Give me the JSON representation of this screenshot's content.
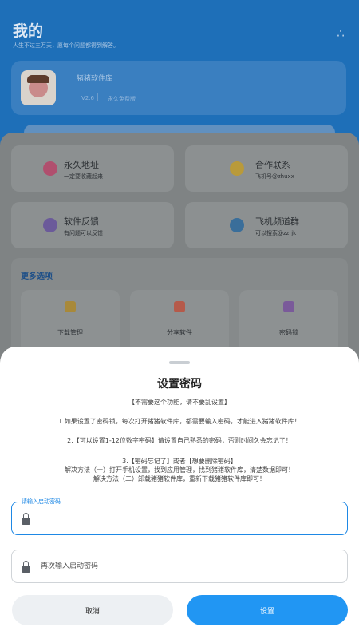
{
  "status_bar": {
    "extra": "1"
  },
  "header": {
    "title": "我的",
    "subtitle": "人生不过三万天，愿每个问题都得到解答。"
  },
  "profile": {
    "name": "猪猪软件库",
    "tag1": "V2.6",
    "tag2": "永久免费版"
  },
  "cards": [
    {
      "title": "永久地址",
      "sub": "一定要收藏起来",
      "icon": "home-icon",
      "color": "#b04f6e"
    },
    {
      "title": "合作联系",
      "sub": "飞机号@zhuxx",
      "icon": "coin-icon",
      "color": "#b99a3a"
    },
    {
      "title": "软件反馈",
      "sub": "有问题可以反馈",
      "icon": "feedback-icon",
      "color": "#6b5a9a"
    },
    {
      "title": "飞机频道群",
      "sub": "可以搜索@zzrjk",
      "icon": "telegram-icon",
      "color": "#3a6e9a"
    }
  ],
  "more": {
    "title": "更多选项",
    "options": [
      {
        "label": "下载管理",
        "icon": "download-icon",
        "color": "#a8893a"
      },
      {
        "label": "分享软件",
        "icon": "share-icon",
        "color": "#b55a4a"
      },
      {
        "label": "密码锁",
        "icon": "lock-icon",
        "color": "#7a5a9a"
      }
    ]
  },
  "sheet": {
    "title": "设置密码",
    "subtitle": "【不需要这个功能，请不要乱设置】",
    "rules": [
      "1.如果设置了密码锁，每次打开猪猪软件库，都需要输入密码，才能进入猪猪软件库！",
      "2.【可以设置1-12位数字密码】请设置自己熟悉的密码，否则时间久会忘记了！",
      "3.【密码忘记了】或者【想要删除密码】\n解决方法（一）打开手机设置，找到应用管理，找到猪猪软件库，清楚数据即可！\n解决方法（二）卸载猪猪软件库，重新下载猪猪软件库即可！"
    ],
    "input1_label": "请输入启动密码",
    "input2_placeholder": "再次输入启动密码",
    "cancel_label": "取消",
    "confirm_label": "设置"
  }
}
